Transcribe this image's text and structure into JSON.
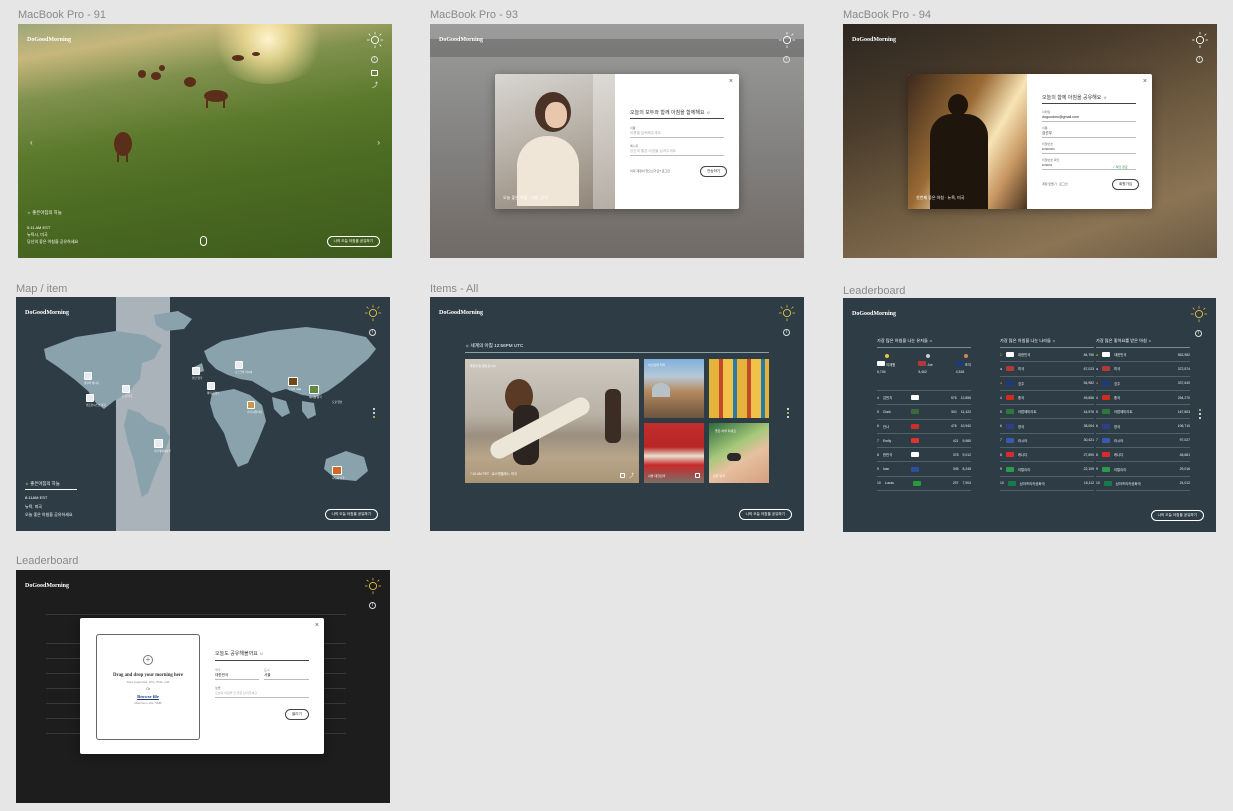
{
  "labels": {
    "f91": "MacBook Pro - 91",
    "f93": "MacBook Pro - 93",
    "f94": "MacBook Pro - 94",
    "map": "Map / item",
    "items": "Items - All",
    "lb1": "Leaderboard",
    "lb2": "Leaderboard"
  },
  "brand": "DoGoodMorning",
  "colors": {
    "slate": "#2e3d45",
    "dark": "#1d1d1d",
    "sun": "#e6c341"
  },
  "f91": {
    "heading": "☼ 좋은아침의 하늘",
    "lines": [
      "5:11 AM EST",
      "뉴욕시, 미국",
      "당신의 좋은 아침을 공유하세요"
    ],
    "cta": "나의 오늘 아침을 공유하기"
  },
  "f93": {
    "title": "오늘의 모두와 함께 아침을 함께해요 ☼",
    "field1_label": "이름",
    "field1_placeholder": "이름을 입력해주세요",
    "field2_label": "메시지",
    "field2_placeholder": "당신의 좋은 아침을 남겨주세요",
    "footer_link": "이미 계정이 있으신가요? 로그인",
    "submit": "전송하기",
    "caption": "오늘 좋은 아침 · 서울, 한국"
  },
  "f94": {
    "title": "오늘의 함께 아침을 공유해요 ☼",
    "email_label": "이메일",
    "email_value": "dogoodmo@gmail.com",
    "name_label": "이름",
    "name_value": "김선우",
    "pw_label": "비밀번호",
    "pw_value": "••••••••••",
    "pw2_label": "비밀번호 확인",
    "pw2_value": "••••••••",
    "ok": "✓ 확인 완료",
    "footer_link": "계정 만들기 · 로그인",
    "submit": "회원가입",
    "caption": "첫번째 좋은 아침 · 뉴욕, 미국"
  },
  "map": {
    "pins": [
      "밴쿠버 캐나다",
      "뉴욕 미국",
      "샌프란시스코 미국",
      "런던 영국",
      "파리 프랑스",
      "로마 이탈리아",
      "모스크바 러시아",
      "두바이 UAE",
      "베이징 중국",
      "도쿄 일본",
      "리우데자네이루",
      "시드니 호주"
    ],
    "heading": "☼ 좋은아침의 하늘",
    "lines": [
      "8:11AM EST",
      "뉴욕, 미국",
      "오늘 좋은 아침을 공유하세요"
    ],
    "cta": "나의 오늘 아침을 공유하기"
  },
  "items": {
    "heading": "☼ 세계의 아침 12:56PM UTC",
    "cap_main": "7:16 AM PDT · 로스앤젤레스, 미국",
    "cap_main_top": "좋은아침 캘리포니아",
    "cap_a": "이스탄불 터키",
    "cap_c": "서울 대한민국",
    "cap_d": "좋은 하루 되세요",
    "cap_e": "런던 영국",
    "cta": "나의 오늘 아침을 공유하기"
  },
  "leaderboard": {
    "col1_title": "가장 많은 아침을 나눈 유저들 ☼",
    "col2_title": "가장 많은 아침을 나눈 나라들 ☼",
    "col3_title": "가장 많은 좋아요를 받은 아침 ☼",
    "top1": [
      {
        "name": "이재원",
        "val": "6,745"
      },
      {
        "name": "Joe",
        "val": "5,462"
      },
      {
        "name": "조이",
        "val": "4,518"
      }
    ],
    "col1_rows": [
      {
        "rank": "4",
        "name": "김민지",
        "count": "576",
        "likes": "12,856"
      },
      {
        "rank": "5",
        "name": "Clark",
        "count": "501",
        "likes": "11,422"
      },
      {
        "rank": "6",
        "name": "안나",
        "count": "476",
        "likes": "10,940"
      },
      {
        "rank": "7",
        "name": "Emily",
        "count": "421",
        "likes": "9,980"
      },
      {
        "rank": "8",
        "name": "한민석",
        "count": "378",
        "likes": "9,012"
      },
      {
        "rank": "9",
        "name": "Ivan",
        "count": "345",
        "likes": "8,245"
      },
      {
        "rank": "10",
        "name": "Lucas",
        "count": "297",
        "likes": "7,904"
      }
    ],
    "col2_rows": [
      {
        "rank": "1",
        "name": "대한민국",
        "val": "84,756"
      },
      {
        "rank": "2",
        "name": "미국",
        "val": "67,023"
      },
      {
        "rank": "3",
        "name": "호주",
        "val": "54,982"
      },
      {
        "rank": "4",
        "name": "중국",
        "val": "49,856"
      },
      {
        "rank": "5",
        "name": "아랍에미리트",
        "val": "44,576"
      },
      {
        "rank": "6",
        "name": "영국",
        "val": "38,004"
      },
      {
        "rank": "7",
        "name": "러시아",
        "val": "30,421"
      },
      {
        "rank": "8",
        "name": "캐나다",
        "val": "27,890"
      },
      {
        "rank": "9",
        "name": "이탈리아",
        "val": "22,109"
      },
      {
        "rank": "10",
        "name": "남아프리카공화국",
        "val": "18,112"
      }
    ],
    "col3_rows": [
      {
        "rank": "1",
        "name": "대한민국",
        "val": "562,982"
      },
      {
        "rank": "2",
        "name": "미국",
        "val": "372,574"
      },
      {
        "rank": "3",
        "name": "호주",
        "val": "337,640"
      },
      {
        "rank": "4",
        "name": "중국",
        "val": "254,270"
      },
      {
        "rank": "5",
        "name": "아랍에미리트",
        "val": "167,803"
      },
      {
        "rank": "6",
        "name": "영국",
        "val": "106,710"
      },
      {
        "rank": "7",
        "name": "러시아",
        "val": "97,027"
      },
      {
        "rank": "8",
        "name": "캐나다",
        "val": "48,681"
      },
      {
        "rank": "9",
        "name": "이탈리아",
        "val": "29,016"
      },
      {
        "rank": "10",
        "name": "남아프리카공화국",
        "val": "24,012"
      }
    ],
    "cta": "나의 오늘 아침을 공유하기"
  },
  "upload": {
    "drop_title": "Drag and drop your morning here",
    "drop_sub": "Files supported: JPG, PNG, GIF",
    "or": "Or",
    "browse": "Browse file",
    "max": "Maximum size: 5MB",
    "title": "오늘도 공유해볼까요 ☼",
    "f1_label": "국가",
    "f1_value": "대한민국",
    "f2_label": "도시",
    "f2_value": "서울",
    "f3_label": "설명",
    "f3_placeholder": "오늘의 아침을 한 줄로 남겨주세요",
    "submit": "올리기"
  },
  "icons": {
    "sun": "sun-icon",
    "info": "info-icon",
    "heart": "heart-icon",
    "share": "share-icon",
    "close": "close-icon",
    "plus": "plus-icon",
    "mouse": "mouse-icon",
    "arrow-left": "arrow-left-icon",
    "arrow-right": "arrow-right-icon",
    "pin": "map-pin-icon",
    "globe": "globe-icon"
  }
}
